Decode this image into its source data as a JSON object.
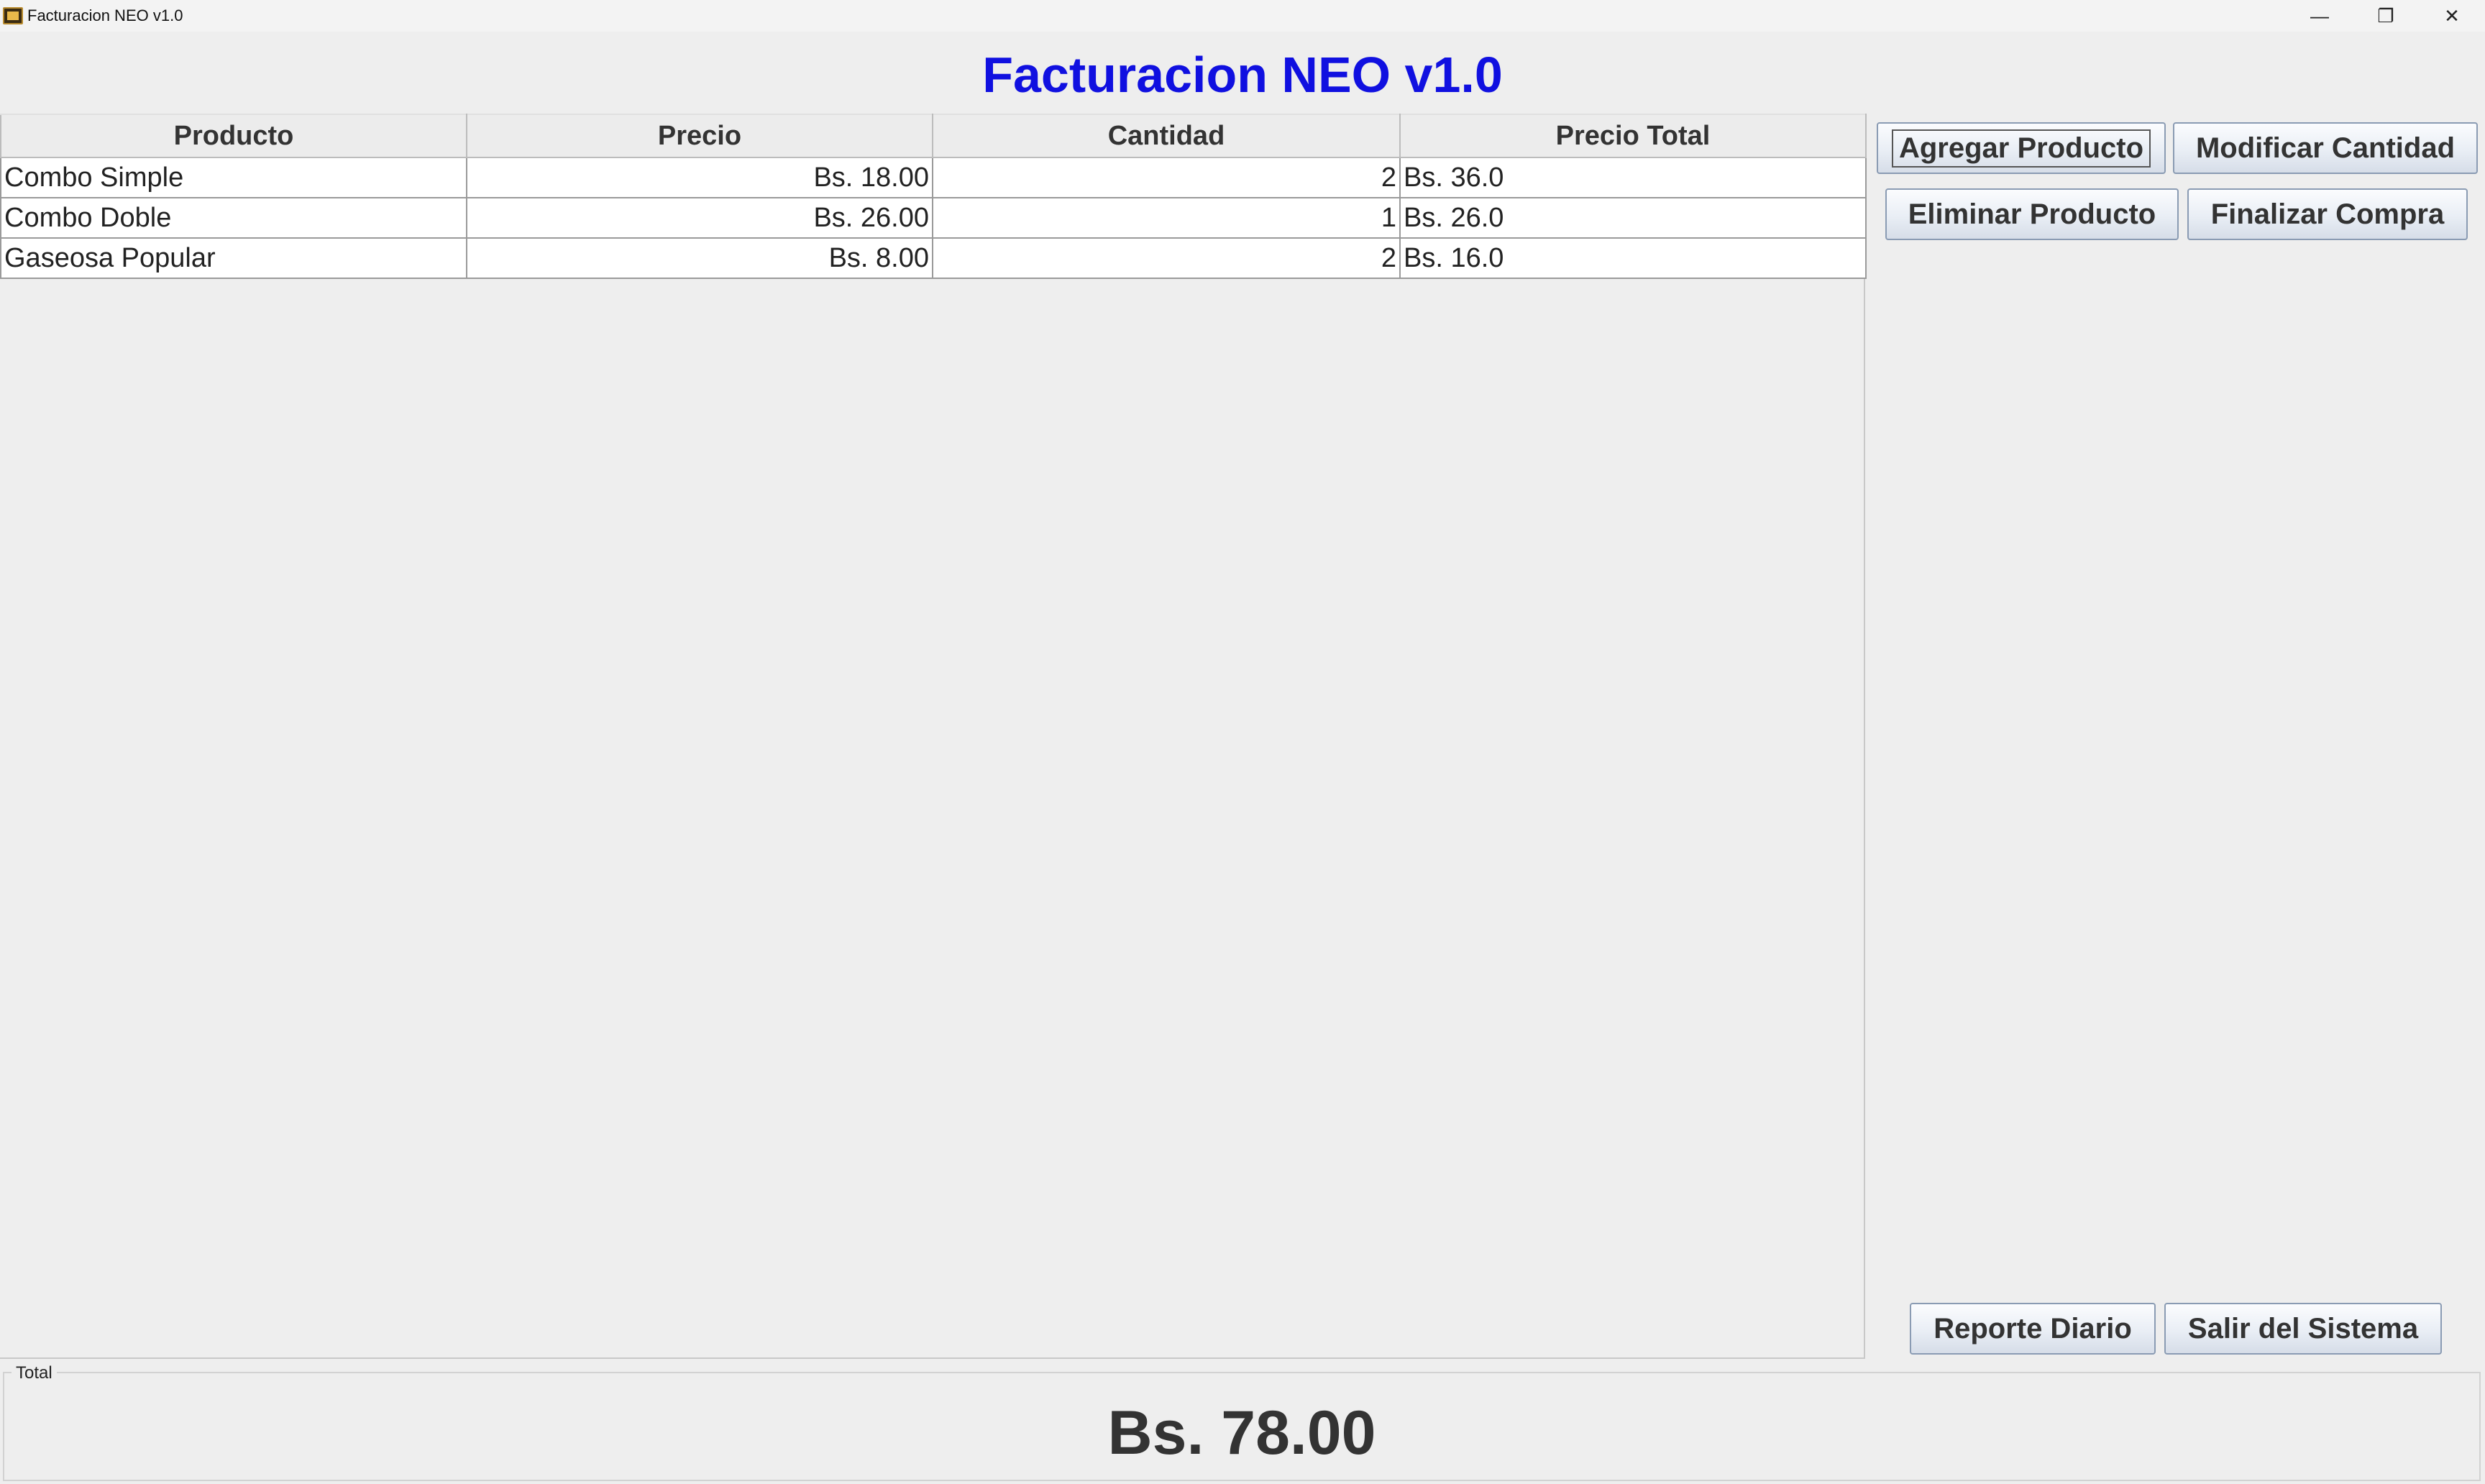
{
  "window": {
    "title": "Facturacion NEO v1.0",
    "controls": {
      "minimize": "—",
      "restore": "❐",
      "close": "✕"
    }
  },
  "heading": {
    "text": "Facturacion NEO v1.0",
    "color": "#1010e0"
  },
  "table": {
    "columns": [
      "Producto",
      "Precio",
      "Cantidad",
      "Precio Total"
    ],
    "rows": [
      {
        "producto": "Combo Simple",
        "precio": "Bs. 18.00",
        "cantidad": "2",
        "total": "Bs. 36.0"
      },
      {
        "producto": "Combo Doble",
        "precio": "Bs. 26.00",
        "cantidad": "1",
        "total": "Bs. 26.0"
      },
      {
        "producto": "Gaseosa Popular",
        "precio": "Bs. 8.00",
        "cantidad": "2",
        "total": "Bs. 16.0"
      }
    ]
  },
  "buttons": {
    "agregar": "Agregar Producto",
    "modificar": "Modificar Cantidad",
    "eliminar": "Eliminar Producto",
    "finalizar": "Finalizar Compra",
    "reporte": "Reporte Diario",
    "salir": "Salir del Sistema"
  },
  "total": {
    "legend": "Total",
    "value": "Bs. 78.00"
  }
}
